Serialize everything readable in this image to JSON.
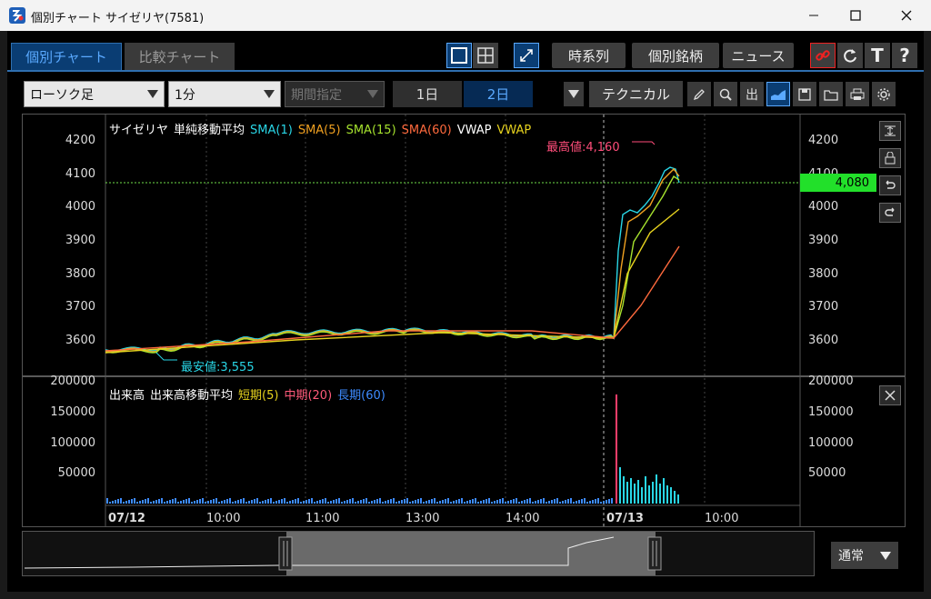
{
  "window": {
    "title": "個別チャート サイゼリヤ(7581)"
  },
  "tabs": [
    {
      "label": "個別チャート",
      "active": true
    },
    {
      "label": "比較チャート",
      "active": false
    }
  ],
  "toolbar": {
    "time_series": "時系列",
    "individual_stock": "個別銘柄",
    "news": "ニュース"
  },
  "controls": {
    "chart_type": "ローソク足",
    "interval": "1分",
    "period": "期間指定",
    "day1": "1日",
    "day2": "2日",
    "technical": "テクニカル",
    "output": "出"
  },
  "price_pane": {
    "legend": [
      {
        "text": "サイゼリヤ",
        "color": "#ffffff"
      },
      {
        "text": "単純移動平均",
        "color": "#ffffff"
      },
      {
        "text": "SMA(1)",
        "color": "#29d6e6"
      },
      {
        "text": "SMA(5)",
        "color": "#f0a020"
      },
      {
        "text": "SMA(15)",
        "color": "#a6e22e"
      },
      {
        "text": "SMA(60)",
        "color": "#ff6a3d"
      },
      {
        "text": "VWAP",
        "color": "#ffffff"
      },
      {
        "text": "VWAP",
        "color": "#e6d21e"
      }
    ],
    "y_ticks": [
      "4200",
      "4100",
      "4000",
      "3900",
      "3800",
      "3700",
      "3600"
    ],
    "current_price": "4,080",
    "high_label": "最高値:4,160",
    "low_label": "最安値:3,555"
  },
  "volume_pane": {
    "legend": [
      {
        "text": "出来高",
        "color": "#ffffff"
      },
      {
        "text": "出来高移動平均",
        "color": "#ffffff"
      },
      {
        "text": "短期(5)",
        "color": "#e6d21e"
      },
      {
        "text": "中期(20)",
        "color": "#ff5a7a"
      },
      {
        "text": "長期(60)",
        "color": "#3d8bff"
      }
    ],
    "y_ticks": [
      "200000",
      "150000",
      "100000",
      "50000"
    ]
  },
  "x_ticks": [
    "07/12",
    "10:00",
    "11:00",
    "13:00",
    "14:00",
    "07/13",
    "10:00"
  ],
  "navigator": {
    "mode": "通常"
  },
  "colors": {
    "accent": "#2f6fb0",
    "current_price_bg": "#22e02a",
    "high_label": "#ff4d7a",
    "low_label": "#29d6e6"
  }
}
